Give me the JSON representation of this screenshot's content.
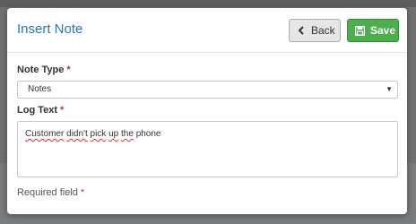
{
  "modal": {
    "title": "Insert Note",
    "back_label": "Back",
    "save_label": "Save"
  },
  "form": {
    "note_type": {
      "label": "Note Type",
      "required_marker": "*",
      "selected": "Notes"
    },
    "log_text": {
      "label": "Log Text",
      "required_marker": "*",
      "words": [
        "Customer",
        "didn't",
        "pick",
        "up",
        "the",
        "phone"
      ]
    },
    "required_note": {
      "text": "Required field",
      "marker": "*"
    }
  },
  "icons": {
    "back": "chevron-left-icon",
    "save": "floppy-disk-icon",
    "dropdown": "caret-down-icon"
  },
  "colors": {
    "title": "#2b74c2",
    "save_button": "#4cae4c",
    "required_marker": "#c9302c",
    "spellcheck_underline": "#e03030"
  }
}
